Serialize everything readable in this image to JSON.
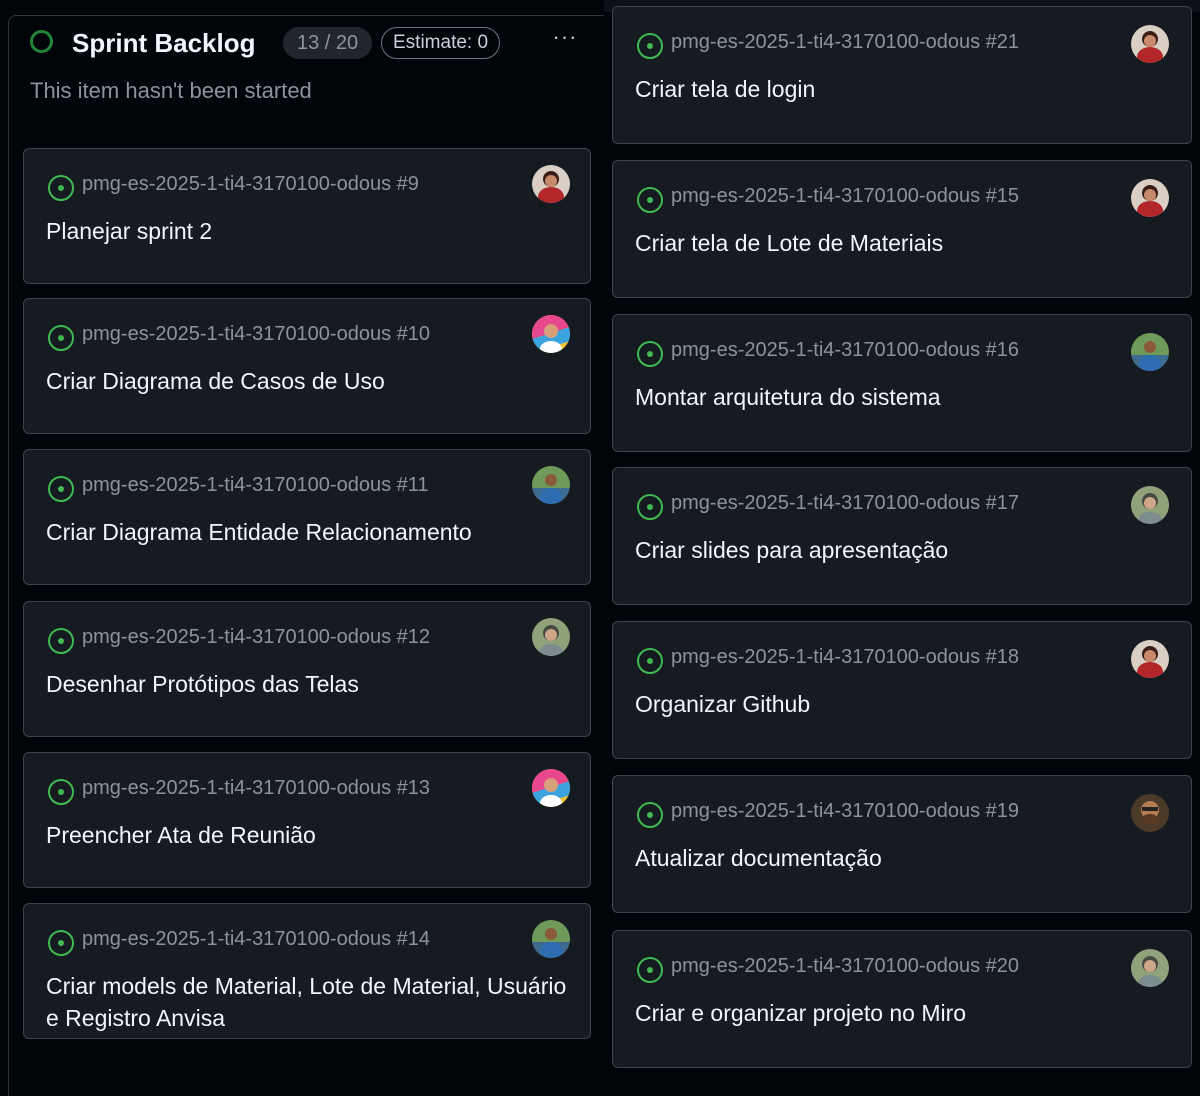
{
  "column": {
    "title": "Sprint Backlog",
    "count": "13 / 20",
    "estimate": "Estimate: 0",
    "menu": "···",
    "description": "This item hasn't been started"
  },
  "colors": {
    "background": "#010409",
    "card": "#161b22",
    "open_green": "#3fb950"
  },
  "left_cards": [
    {
      "ref": "pmg-es-2025-1-ti4-3170100-odous #9",
      "title": "Planejar sprint 2",
      "avatar": "red-avatar"
    },
    {
      "ref": "pmg-es-2025-1-ti4-3170100-odous #10",
      "title": "Criar Diagrama de Casos de Uso",
      "avatar": "colorful-avatar"
    },
    {
      "ref": "pmg-es-2025-1-ti4-3170100-odous #11",
      "title": "Criar Diagrama Entidade Relacionamento",
      "avatar": "blue-avatar"
    },
    {
      "ref": "pmg-es-2025-1-ti4-3170100-odous #12",
      "title": "Desenhar Protótipos das Telas",
      "avatar": "gray-avatar"
    },
    {
      "ref": "pmg-es-2025-1-ti4-3170100-odous #13",
      "title": "Preencher Ata de Reunião",
      "avatar": "colorful-avatar"
    },
    {
      "ref": "pmg-es-2025-1-ti4-3170100-odous #14",
      "title": "Criar models de Material, Lote de Material, Usuário e Registro Anvisa",
      "avatar": "blue-avatar"
    }
  ],
  "right_cards": [
    {
      "ref": "pmg-es-2025-1-ti4-3170100-odous #21",
      "title": "Criar tela de login",
      "avatar": "red-avatar"
    },
    {
      "ref": "pmg-es-2025-1-ti4-3170100-odous #15",
      "title": "Criar tela de Lote de Materiais",
      "avatar": "red-avatar"
    },
    {
      "ref": "pmg-es-2025-1-ti4-3170100-odous #16",
      "title": "Montar arquitetura do sistema",
      "avatar": "blue-avatar"
    },
    {
      "ref": "pmg-es-2025-1-ti4-3170100-odous #17",
      "title": "Criar slides para apresentação",
      "avatar": "gray-avatar"
    },
    {
      "ref": "pmg-es-2025-1-ti4-3170100-odous #18",
      "title": "Organizar Github",
      "avatar": "red-avatar"
    },
    {
      "ref": "pmg-es-2025-1-ti4-3170100-odous #19",
      "title": "Atualizar documentação",
      "avatar": "brown-avatar"
    },
    {
      "ref": "pmg-es-2025-1-ti4-3170100-odous #20",
      "title": "Criar e organizar projeto no Miro",
      "avatar": "gray-avatar"
    }
  ]
}
